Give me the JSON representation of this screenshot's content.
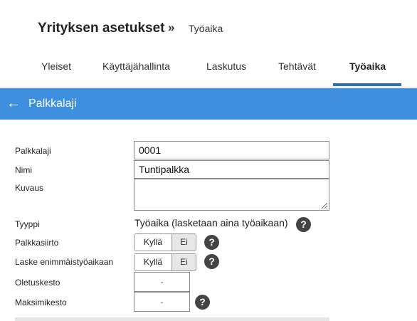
{
  "breadcrumb": {
    "title": "Yrityksen asetukset",
    "separator": "»",
    "current": "Työaika"
  },
  "tabs": [
    {
      "label": "Yleiset",
      "active": false
    },
    {
      "label": "Käyttäjähallinta",
      "active": false
    },
    {
      "label": "Laskutus",
      "active": false
    },
    {
      "label": "Tehtävät",
      "active": false
    },
    {
      "label": "Työaika",
      "active": true
    }
  ],
  "header_bar": {
    "title": "Palkkalaji",
    "back_icon": "arrow-left-icon",
    "color": "#3f8fdf"
  },
  "form": {
    "palkkalaji": {
      "label": "Palkkalaji",
      "value": "0001"
    },
    "nimi": {
      "label": "Nimi",
      "value": "Tuntipalkka"
    },
    "kuvaus": {
      "label": "Kuvaus",
      "value": ""
    },
    "tyyppi": {
      "label": "Tyyppi",
      "value": "Työaika (lasketaan aina työaikaan)"
    },
    "palkkasiirto": {
      "label": "Palkkasiirto",
      "yes": "Kyllä",
      "no": "Ei"
    },
    "laske_enimmaistyoaikaan": {
      "label": "Laske enimmäistyöaikaan",
      "yes": "Kyllä",
      "no": "Ei"
    },
    "oletuskesto": {
      "label": "Oletuskesto",
      "value": "-"
    },
    "maksimikesto": {
      "label": "Maksimikesto",
      "value": "-"
    }
  },
  "help_icon": {
    "glyph": "?"
  }
}
